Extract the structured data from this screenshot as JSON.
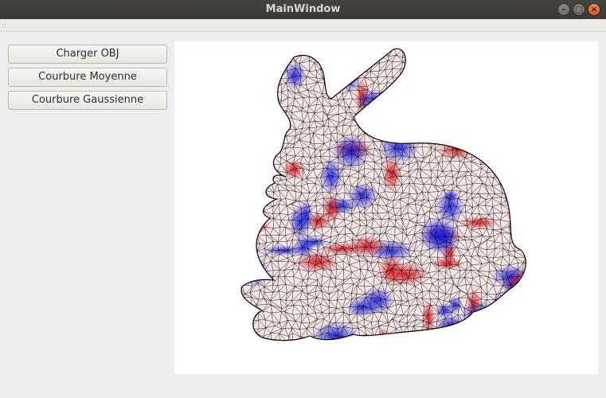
{
  "window": {
    "title": "MainWindow"
  },
  "titlebar_buttons": {
    "minimize": "–",
    "maximize": "□",
    "close": "×"
  },
  "sidebar": {
    "buttons": [
      {
        "label": "Charger OBJ"
      },
      {
        "label": "Courbure Moyenne"
      },
      {
        "label": "Courbure Gaussienne"
      }
    ]
  },
  "viewport": {
    "content": "mesh-view",
    "colors": {
      "positive": "#e0202a",
      "negative": "#1a24e6",
      "neutral": "#ffffff",
      "wire": "#000000"
    }
  }
}
